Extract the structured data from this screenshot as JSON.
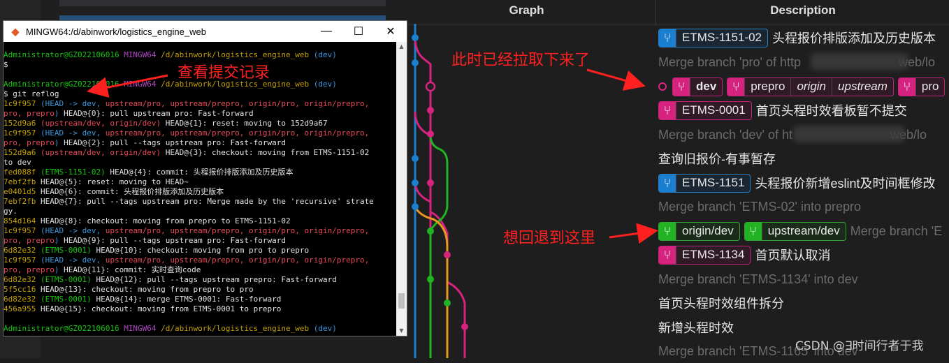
{
  "git_graph": {
    "columns": {
      "graph": "Graph",
      "description": "Description"
    },
    "colors": {
      "blue": "#1a7fd0",
      "pink": "#d6237f",
      "green": "#22b322",
      "orange": "#e8961e"
    },
    "rows": [
      {
        "type": "tag",
        "tags": [
          {
            "label": "ETMS-1151-02",
            "color": "blue"
          }
        ],
        "message": "头程报价排版添加及历史版本"
      },
      {
        "type": "merge",
        "message": "Merge branch 'pro' of http",
        "message_tail": "web/lo"
      },
      {
        "type": "tag",
        "head": true,
        "tags": [
          {
            "label": "dev",
            "color": "pink",
            "bold": true
          },
          {
            "label": "prepro",
            "color": "pink",
            "remotes": [
              "origin",
              "upstream"
            ]
          },
          {
            "label": "pro",
            "color": "pink"
          }
        ],
        "message": ""
      },
      {
        "type": "tag",
        "tags": [
          {
            "label": "ETMS-0001",
            "color": "pink"
          }
        ],
        "message": "首页头程时效看板暂不提交"
      },
      {
        "type": "merge",
        "message": "Merge branch 'dev' of ht",
        "message_tail": "web/lo"
      },
      {
        "type": "plain",
        "tags": [],
        "message": "查询旧报价-有事暂存"
      },
      {
        "type": "tag",
        "tags": [
          {
            "label": "ETMS-1151",
            "color": "blue"
          }
        ],
        "message": "头程报价新增eslint及时间框修改"
      },
      {
        "type": "merge",
        "message": "Merge branch 'ETMS-02' into prepro"
      },
      {
        "type": "tag",
        "tags": [
          {
            "label": "origin/dev",
            "color": "green"
          },
          {
            "label": "upstream/dev",
            "color": "green"
          }
        ],
        "message": "Merge branch 'E",
        "message_merge": true
      },
      {
        "type": "tag",
        "tags": [
          {
            "label": "ETMS-1134",
            "color": "pink"
          }
        ],
        "message": "首页默认取消"
      },
      {
        "type": "merge",
        "message": "Merge branch 'ETMS-1134' into dev"
      },
      {
        "type": "plain",
        "tags": [],
        "message": "首页头程时效组件拆分"
      },
      {
        "type": "plain",
        "tags": [],
        "message": "新增头程时效"
      },
      {
        "type": "merge",
        "message": "Merge branch 'ETMS-1165' into dev"
      }
    ]
  },
  "terminal": {
    "title": "MINGW64:/d/abinwork/logistics_engine_web",
    "controls": {
      "minimize": "—",
      "maximize": "☐",
      "close": "✕"
    },
    "lines": [
      [
        [
          "g",
          "Administrator@GZ022106016 "
        ],
        [
          "m",
          "MINGW64 "
        ],
        [
          "y",
          "/d/abinwork/logistics_engine_web "
        ],
        [
          "c",
          "(dev)"
        ]
      ],
      [
        [
          "w",
          "$"
        ]
      ],
      [
        [
          "w",
          ""
        ]
      ],
      [
        [
          "g",
          "Administrator@GZ022106016 "
        ],
        [
          "m",
          "MINGW64 "
        ],
        [
          "y",
          "/d/abinwork/logistics_engine_web "
        ],
        [
          "c",
          "(dev)"
        ]
      ],
      [
        [
          "w",
          "$ git reflog"
        ]
      ],
      [
        [
          "y",
          "1c9f957 "
        ],
        [
          "c",
          "(HEAD -> dev, "
        ],
        [
          "r",
          "upstream/pro, upstream/prepro, origin/pro, origin/prepro,"
        ]
      ],
      [
        [
          "r",
          "pro, prepro"
        ],
        [
          "c",
          ")"
        ],
        [
          "w",
          " HEAD@{0}: pull upstream pro: Fast-forward"
        ]
      ],
      [
        [
          "y",
          "152d9a6 "
        ],
        [
          "r",
          "(upstream/dev, origin/dev)"
        ],
        [
          "w",
          " HEAD@{1}: reset: moving to 152d9a67"
        ]
      ],
      [
        [
          "y",
          "1c9f957 "
        ],
        [
          "c",
          "(HEAD -> dev, "
        ],
        [
          "r",
          "upstream/pro, upstream/prepro, origin/pro, origin/prepro,"
        ]
      ],
      [
        [
          "r",
          "pro, prepro"
        ],
        [
          "c",
          ")"
        ],
        [
          "w",
          " HEAD@{2}: pull --tags upstream pro: Fast-forward"
        ]
      ],
      [
        [
          "y",
          "152d9a6 "
        ],
        [
          "r",
          "(upstream/dev, origin/dev)"
        ],
        [
          "w",
          " HEAD@{3}: checkout: moving from ETMS-1151-02"
        ]
      ],
      [
        [
          "w",
          "to dev"
        ]
      ],
      [
        [
          "y",
          "fed088f "
        ],
        [
          "g",
          "(ETMS-1151-02)"
        ],
        [
          "w",
          " HEAD@{4}: commit: 头程报价排版添加及历史版本"
        ]
      ],
      [
        [
          "y",
          "7ebf2fb "
        ],
        [
          "w",
          "HEAD@{5}: reset: moving to HEAD~"
        ]
      ],
      [
        [
          "y",
          "e0401d5 "
        ],
        [
          "w",
          "HEAD@{6}: commit: 头程报价排版添加及历史版本"
        ]
      ],
      [
        [
          "y",
          "7ebf2fb "
        ],
        [
          "w",
          "HEAD@{7}: pull --tags upstream pro: Merge made by the 'recursive' strate"
        ]
      ],
      [
        [
          "w",
          "gy."
        ]
      ],
      [
        [
          "y",
          "854d164 "
        ],
        [
          "w",
          "HEAD@{8}: checkout: moving from prepro to ETMS-1151-02"
        ]
      ],
      [
        [
          "y",
          "1c9f957 "
        ],
        [
          "c",
          "(HEAD -> dev, "
        ],
        [
          "r",
          "upstream/pro, upstream/prepro, origin/pro, origin/prepro,"
        ]
      ],
      [
        [
          "r",
          "pro, prepro"
        ],
        [
          "c",
          ")"
        ],
        [
          "w",
          " HEAD@{9}: pull --tags upstream pro: Fast-forward"
        ]
      ],
      [
        [
          "y",
          "6d82e32 "
        ],
        [
          "g",
          "(ETMS-0001)"
        ],
        [
          "w",
          " HEAD@{10}: checkout: moving from pro to prepro"
        ]
      ],
      [
        [
          "y",
          "1c9f957 "
        ],
        [
          "c",
          "(HEAD -> dev, "
        ],
        [
          "r",
          "upstream/pro, upstream/prepro, origin/pro, origin/prepro,"
        ]
      ],
      [
        [
          "r",
          "pro, prepro"
        ],
        [
          "c",
          ")"
        ],
        [
          "w",
          " HEAD@{11}: commit: 实时查询code"
        ]
      ],
      [
        [
          "y",
          "6d82e32 "
        ],
        [
          "g",
          "(ETMS-0001)"
        ],
        [
          "w",
          " HEAD@{12}: pull --tags upstream prepro: Fast-forward"
        ]
      ],
      [
        [
          "y",
          "5f5cc16 "
        ],
        [
          "w",
          "HEAD@{13}: checkout: moving from prepro to pro"
        ]
      ],
      [
        [
          "y",
          "6d82e32 "
        ],
        [
          "g",
          "(ETMS-0001)"
        ],
        [
          "w",
          " HEAD@{14}: merge ETMS-0001: Fast-forward"
        ]
      ],
      [
        [
          "y",
          "456a955 "
        ],
        [
          "w",
          "HEAD@{15}: checkout: moving from ETMS-0001 to prepro"
        ]
      ],
      [
        [
          "w",
          ""
        ]
      ],
      [
        [
          "g",
          "Administrator@GZ022106016 "
        ],
        [
          "m",
          "MINGW64 "
        ],
        [
          "y",
          "/d/abinwork/logistics_engine_web "
        ],
        [
          "c",
          "(dev)"
        ]
      ]
    ]
  },
  "annotations": {
    "view_commits": "查看提交记录",
    "pulled_down": "此时已经拉取下来了",
    "rollback_here": "想回退到这里"
  },
  "watermark": "CSDN @∃时间行者于我"
}
